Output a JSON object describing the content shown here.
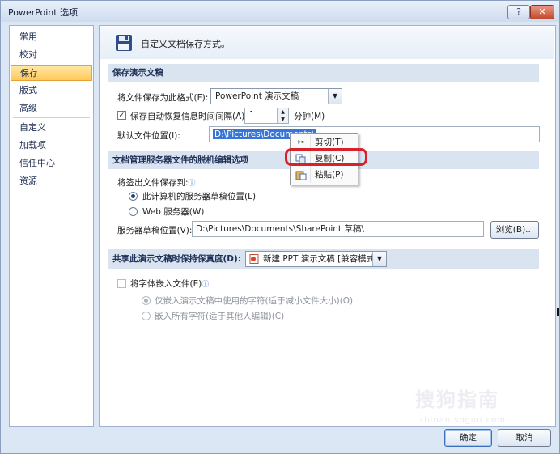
{
  "window": {
    "title": "PowerPoint 选项",
    "help_label": "?",
    "close_label": "✕"
  },
  "nav": {
    "items": [
      "常用",
      "校对",
      "保存",
      "版式",
      "高级",
      "自定义",
      "加载项",
      "信任中心",
      "资源"
    ],
    "selected": "保存"
  },
  "banner": {
    "text": "自定义文档保存方式。",
    "icon": "floppy-disk-icon"
  },
  "save_section": {
    "title": "保存演示文稿",
    "format_label": "将文件保存为此格式(F):",
    "format_value": "PowerPoint 演示文稿",
    "autorecover_label": "保存自动恢复信息时间间隔(A)",
    "autorecover_checked": true,
    "autorecover_value": "1",
    "minutes_label": "分钟(M)",
    "default_location_label": "默认文件位置(I):",
    "default_location_value": "D:\\Pictures\\Documents\\"
  },
  "server_section": {
    "title": "文档管理服务器文件的脱机编辑选项",
    "checkout_label": "将签出文件保存到:",
    "option_local": "此计算机的服务器草稿位置(L)",
    "option_web": "Web 服务器(W)",
    "drafts_label": "服务器草稿位置(V):",
    "drafts_value": "D:\\Pictures\\Documents\\SharePoint 草稿\\",
    "browse_label": "浏览(B)..."
  },
  "fidelity_section": {
    "title": "共享此演示文稿时保持保真度(D):",
    "doc_value": "新建 PPT 演示文稿 [兼容模式]",
    "embed_label": "将字体嵌入文件(E)",
    "embed_checked": false,
    "option_used_chars": "仅嵌入演示文稿中使用的字符(适于减小文件大小)(O)",
    "option_all_chars": "嵌入所有字符(适于其他人编辑)(C)"
  },
  "context_menu": {
    "items": [
      {
        "label": "剪切(T)",
        "icon": "scissors-icon"
      },
      {
        "label": "复制(C)",
        "icon": "copy-icon"
      },
      {
        "label": "粘贴(P)",
        "icon": "paste-icon"
      }
    ]
  },
  "footer": {
    "ok_label": "确定",
    "cancel_label": "取消"
  },
  "watermark": {
    "text": "搜狗指南",
    "subtext": "zhinan.sogou.com"
  },
  "colors": {
    "selected_nav": "#ffc85a",
    "highlight_ring": "#d8222b",
    "section_bg": "#dae4f1"
  }
}
